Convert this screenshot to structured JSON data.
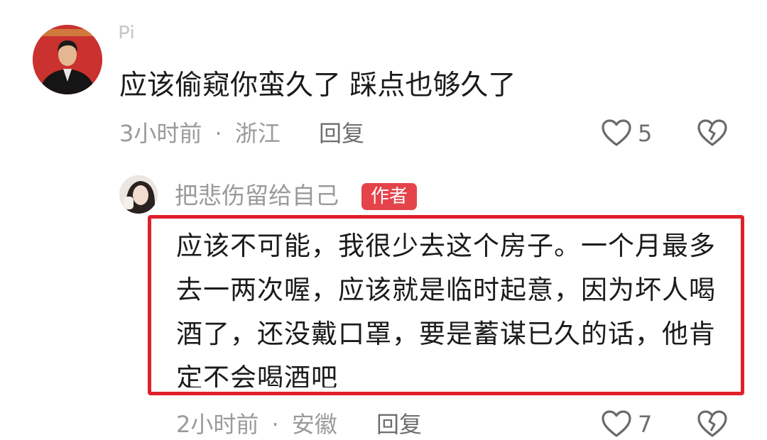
{
  "comment1": {
    "username": "Pi",
    "text": "应该偷窥你蛮久了 踩点也够久了",
    "time": "3小时前",
    "separator": "·",
    "location": "浙江",
    "reply_label": "回复",
    "likes": "5",
    "like_icon": "heart-outline-icon",
    "dislike_icon": "broken-heart-icon"
  },
  "comment2": {
    "username": "把悲伤留给自己",
    "author_badge": "作者",
    "text": "应该不可能，我很少去这个房子。一个月最多去一两次喔，应该就是临时起意，因为坏人喝酒了，还没戴口罩，要是蓄谋已久的话，他肯定不会喝酒吧",
    "time": "2小时前",
    "separator": "·",
    "location": "安徽",
    "reply_label": "回复",
    "likes": "7",
    "like_icon": "heart-outline-icon",
    "dislike_icon": "broken-heart-icon"
  },
  "colors": {
    "badge": "#e4434a",
    "highlight_box": "#e0202a",
    "meta_text": "#9a9a9a",
    "body_text": "#1b1b1b"
  }
}
